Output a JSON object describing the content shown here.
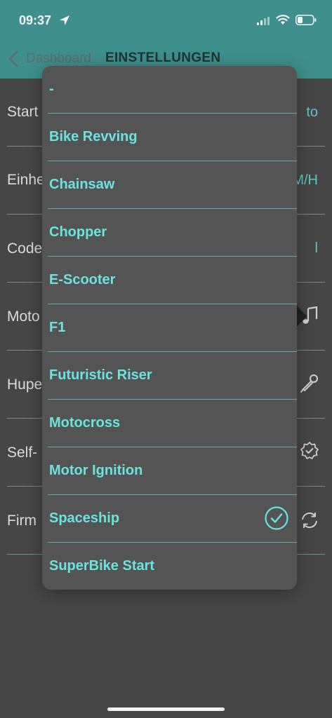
{
  "status_bar": {
    "time": "09:37",
    "icons": [
      "location-arrow-icon",
      "signal-icon",
      "wifi-icon",
      "battery-icon"
    ]
  },
  "header": {
    "back_label": "Dashboard",
    "title": "EINSTELLUNGEN"
  },
  "settings": [
    {
      "label": "Start",
      "value": "to"
    },
    {
      "label": "Einhe",
      "value": "M/H"
    },
    {
      "label": "Code",
      "value": "l"
    },
    {
      "label": "Moto",
      "icon": "music-note-icon"
    },
    {
      "label": "Hupe",
      "icon": "microphone-icon"
    },
    {
      "label": "Self-",
      "icon": "verified-badge-icon"
    },
    {
      "label": "Firm",
      "icon": "sync-icon"
    }
  ],
  "menu": {
    "items": [
      {
        "label": "-"
      },
      {
        "label": "Bike Revving"
      },
      {
        "label": "Chainsaw"
      },
      {
        "label": "Chopper"
      },
      {
        "label": "E-Scooter"
      },
      {
        "label": "F1"
      },
      {
        "label": "Futuristic Riser"
      },
      {
        "label": "Motocross"
      },
      {
        "label": "Motor Ignition"
      },
      {
        "label": "Spaceship",
        "selected": true
      },
      {
        "label": "SuperBike Start"
      }
    ]
  },
  "colors": {
    "accent": "#6be3de",
    "header_bg": "#3f8f8c",
    "background": "#464646",
    "menu_bg": "#545454"
  }
}
